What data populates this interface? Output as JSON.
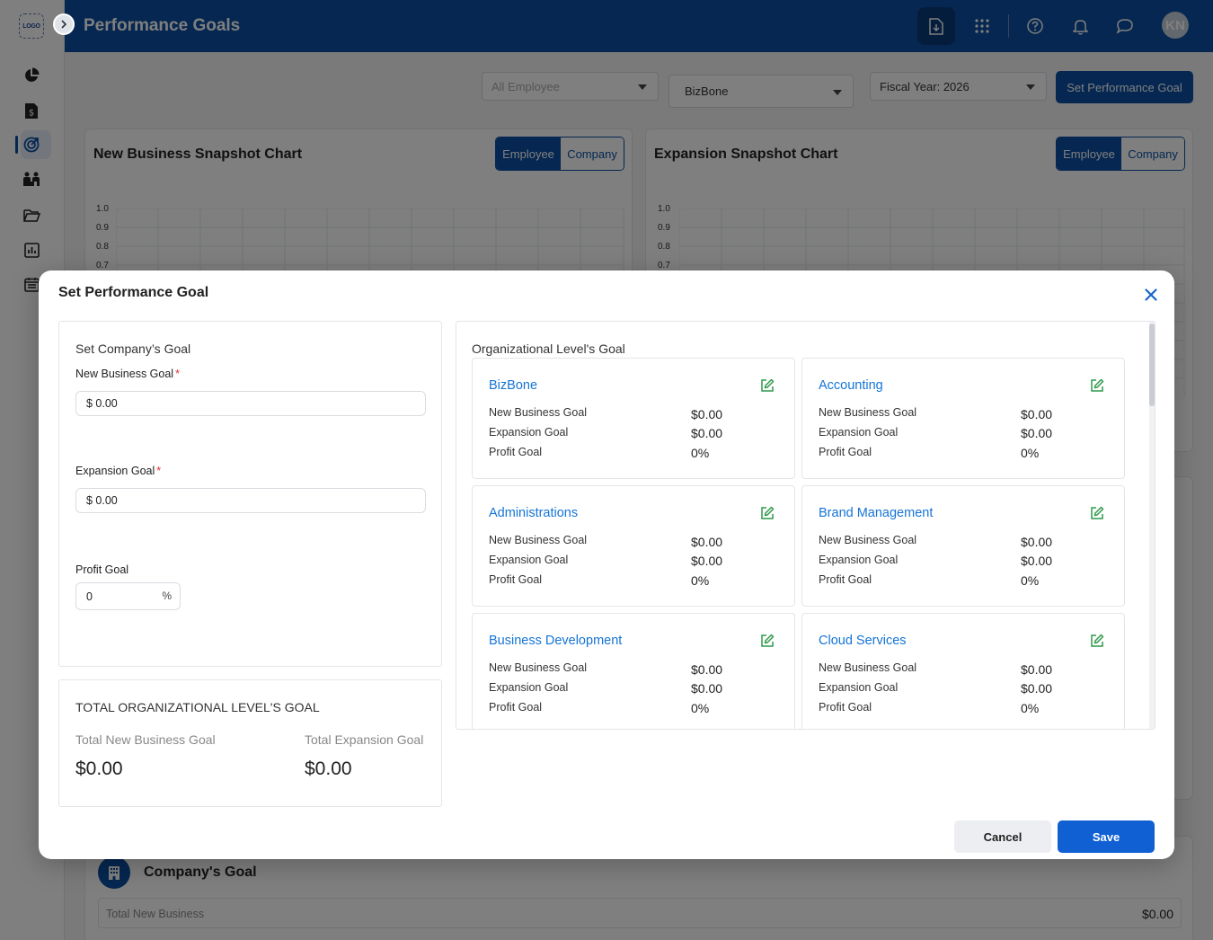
{
  "app": {
    "logo_text": "LOGO",
    "page_title": "Performance Goals",
    "avatar_initials": "KN",
    "brand_color": "#0b4ea2",
    "sidebar_icons": [
      "dashboard-pie-icon",
      "invoice-dollar-icon",
      "goals-target-icon",
      "team-icon",
      "folder-open-icon",
      "reports-chart-icon",
      "calendar-icon"
    ],
    "active_sidebar_icon": "goals-target-icon",
    "header_icons": [
      "download-file-icon",
      "apps-grid-icon",
      "help-icon",
      "bell-icon",
      "chat-icon"
    ]
  },
  "filters": {
    "employee": "All Employee",
    "organization": "BizBone",
    "fiscal_year": "Fiscal Year: 2026",
    "set_goal_label": "Set Performance Goal"
  },
  "charts": {
    "new_business": {
      "title": "New Business Snapshot Chart",
      "toggle": [
        "Employee",
        "Company"
      ],
      "active": "Employee"
    },
    "expansion": {
      "title": "Expansion Snapshot Chart",
      "toggle": [
        "Employee",
        "Company"
      ],
      "active": "Employee"
    },
    "y_ticks": [
      "1.0",
      "0.9",
      "0.8",
      "0.7"
    ]
  },
  "company_goal_section": {
    "title": "Company's Goal",
    "row_label": "Total New Business",
    "row_value": "$0.00"
  },
  "modal": {
    "title": "Set Performance Goal",
    "company": {
      "heading": "Set Company’s Goal",
      "new_business_label": "New Business Goal",
      "new_business_value": "$ 0.00",
      "expansion_label": "Expansion Goal",
      "expansion_value": "$ 0.00",
      "profit_label": "Profit Goal",
      "profit_value": "0",
      "profit_unit": "%",
      "required_mark": "*"
    },
    "totals": {
      "heading": "TOTAL ORGANIZATIONAL LEVEL'S GOAL",
      "new_business_label": "Total New Business Goal",
      "new_business_value": "$0.00",
      "expansion_label": "Total Expansion Goal",
      "expansion_value": "$0.00"
    },
    "org": {
      "heading": "Organizational Level's Goal",
      "row_labels": [
        "New Business Goal",
        "Expansion Goal",
        "Profit Goal"
      ],
      "items": [
        {
          "name": "BizBone",
          "new_business": "$0.00",
          "expansion": "$0.00",
          "profit": "0%"
        },
        {
          "name": "Accounting",
          "new_business": "$0.00",
          "expansion": "$0.00",
          "profit": "0%"
        },
        {
          "name": "Administrations",
          "new_business": "$0.00",
          "expansion": "$0.00",
          "profit": "0%"
        },
        {
          "name": "Brand Management",
          "new_business": "$0.00",
          "expansion": "$0.00",
          "profit": "0%"
        },
        {
          "name": "Business Development",
          "new_business": "$0.00",
          "expansion": "$0.00",
          "profit": "0%"
        },
        {
          "name": "Cloud Services",
          "new_business": "$0.00",
          "expansion": "$0.00",
          "profit": "0%"
        }
      ]
    },
    "cancel_label": "Cancel",
    "save_label": "Save"
  }
}
